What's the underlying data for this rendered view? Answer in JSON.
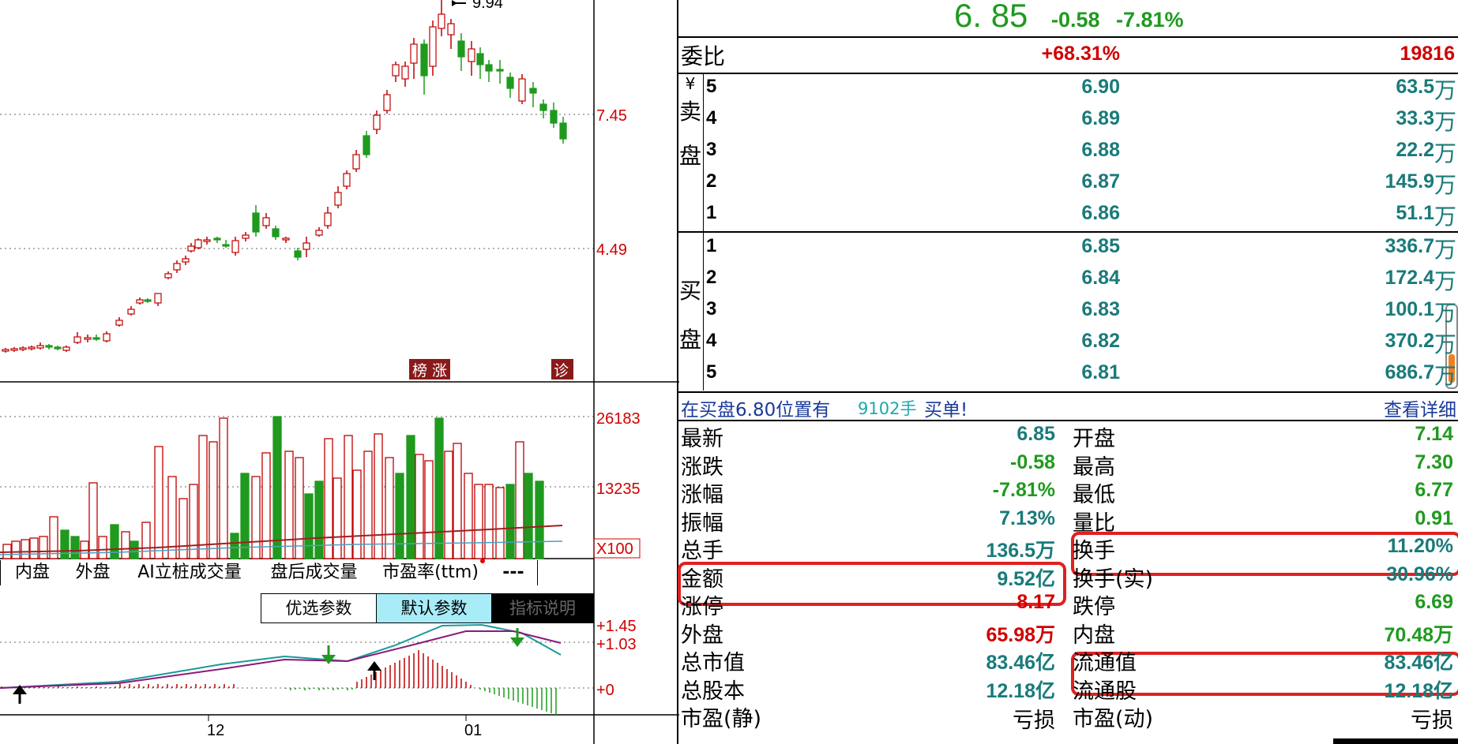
{
  "colors": {
    "up": "#c00000",
    "down": "#1f9a1f",
    "teal": "#1a7a7a",
    "highlight": "#e02020",
    "grid": "#444444"
  },
  "price_axis": {
    "labels": [
      "9.94",
      "7.45",
      "4.49"
    ]
  },
  "price_badges": {
    "rank": "榜",
    "rise": "涨",
    "diag": "诊"
  },
  "volume_axis": {
    "labels": [
      "26183",
      "13235",
      "X100"
    ]
  },
  "macd_axis": {
    "labels": [
      "+1.45",
      "+1.03",
      "+0"
    ]
  },
  "time_axis": {
    "labels": [
      "12",
      "01"
    ]
  },
  "tabs": [
    "内盘",
    "外盘",
    "AI立桩成交量",
    "盘后成交量",
    "市盈率(ttm)",
    "---"
  ],
  "buttons": {
    "custom": "优选参数",
    "default": "默认参数",
    "explain": "指标说明"
  },
  "quote": {
    "price": "6. 85",
    "change": "-0.58",
    "change_pct": "-7.81%"
  },
  "order_ratio": {
    "label": "委比",
    "pct": "+68.31%",
    "diff": "19816"
  },
  "sell_side": {
    "currency": "¥",
    "label_chars": [
      "卖",
      "盘"
    ],
    "levels": [
      {
        "n": "5",
        "price": "6.90",
        "vol": "63.5",
        "unit": "万"
      },
      {
        "n": "4",
        "price": "6.89",
        "vol": "33.3",
        "unit": "万"
      },
      {
        "n": "3",
        "price": "6.88",
        "vol": "22.2",
        "unit": "万"
      },
      {
        "n": "2",
        "price": "6.87",
        "vol": "145.9",
        "unit": "万"
      },
      {
        "n": "1",
        "price": "6.86",
        "vol": "51.1",
        "unit": "万"
      }
    ]
  },
  "buy_side": {
    "label_chars": [
      "买",
      "盘"
    ],
    "levels": [
      {
        "n": "1",
        "price": "6.85",
        "vol": "336.7",
        "unit": "万"
      },
      {
        "n": "2",
        "price": "6.84",
        "vol": "172.4",
        "unit": "万"
      },
      {
        "n": "3",
        "price": "6.83",
        "vol": "100.1",
        "unit": "万"
      },
      {
        "n": "4",
        "price": "6.82",
        "vol": "370.2",
        "unit": "万"
      },
      {
        "n": "5",
        "price": "6.81",
        "vol": "686.7",
        "unit": "万"
      }
    ]
  },
  "notice": {
    "text1": "在买盘6.80位置有",
    "lots": "9102手",
    "text2": "买单!",
    "link": "查看详细"
  },
  "stats_left": [
    {
      "label": "最新",
      "value": "6.85",
      "color": "teal"
    },
    {
      "label": "涨跌",
      "value": "-0.58",
      "color": "green"
    },
    {
      "label": "涨幅",
      "value": "-7.81%",
      "color": "green"
    },
    {
      "label": "振幅",
      "value": "7.13%",
      "color": "teal"
    },
    {
      "label": "总手",
      "value": "136.5万",
      "color": "teal"
    },
    {
      "label": "金额",
      "value": "9.52亿",
      "color": "teal"
    },
    {
      "label": "涨停",
      "value": "8.17",
      "color": "red"
    },
    {
      "label": "外盘",
      "value": "65.98万",
      "color": "red"
    },
    {
      "label": "总市值",
      "value": "83.46亿",
      "color": "teal"
    },
    {
      "label": "总股本",
      "value": "12.18亿",
      "color": "teal"
    },
    {
      "label": "市盈(静)",
      "value": "亏损",
      "color": "black"
    }
  ],
  "stats_right": [
    {
      "label": "开盘",
      "value": "7.14",
      "color": "green"
    },
    {
      "label": "最高",
      "value": "7.30",
      "color": "green"
    },
    {
      "label": "最低",
      "value": "6.77",
      "color": "green"
    },
    {
      "label": "量比",
      "value": "0.91",
      "color": "green"
    },
    {
      "label": "换手",
      "value": "11.20%",
      "color": "teal"
    },
    {
      "label": "换手(实)",
      "value": "30.96%",
      "color": "teal"
    },
    {
      "label": "跌停",
      "value": "6.69",
      "color": "green"
    },
    {
      "label": "内盘",
      "value": "70.48万",
      "color": "green"
    },
    {
      "label": "流通值",
      "value": "83.46亿",
      "color": "teal"
    },
    {
      "label": "流通股",
      "value": "12.18亿",
      "color": "teal"
    },
    {
      "label": "市盈(动)",
      "value": "亏损",
      "color": "black"
    }
  ]
}
